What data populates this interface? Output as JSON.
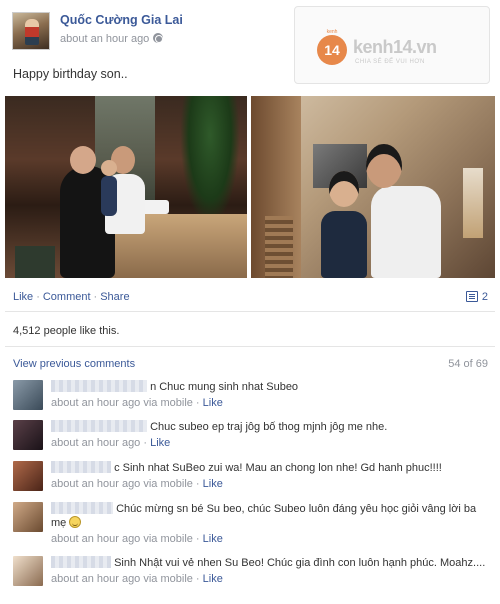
{
  "post": {
    "author": "Quốc Cường Gia Lai",
    "timestamp": "about an hour ago",
    "text": "Happy birthday son..",
    "watermark": {
      "logo": "14",
      "logo_top": "kenh",
      "brand": "kenh14.vn",
      "tagline": "CHIA SẺ ĐỂ VUI HƠN"
    }
  },
  "actions": {
    "like": "Like",
    "comment": "Comment",
    "share": "Share",
    "comment_count": "2"
  },
  "likes_text": "4,512 people like this.",
  "view_previous": "View previous comments",
  "page_count": "54 of 69",
  "comments": [
    {
      "text": "n Chuc mung sinh nhat Subeo",
      "meta": "about an hour ago via mobile · ",
      "like": "Like",
      "avatar_color": "#6a7a88"
    },
    {
      "text": "Chuc subeo ep traj jôg bố thog mjnh jôg me nhe.",
      "meta": "about an hour ago · ",
      "like": "Like",
      "avatar_color": "#3a2a30"
    },
    {
      "text": "c Sinh nhat SuBeo zui wa! Mau an chong lon nhe! Gd hanh phuc!!!!",
      "meta": "about an hour ago via mobile · ",
      "like": "Like",
      "avatar_color": "#8a4a3a"
    },
    {
      "text": "Chúc mừng sn bé Su beo, chúc Subeo luôn đáng yêu học giỏi vâng lời ba mẹ",
      "meta": "about an hour ago via mobile · ",
      "like": "Like",
      "avatar_color": "#b08a6a"
    },
    {
      "text": "Sinh Nhật vui vẻ nhen Su Beo! Chúc gia đình con luôn hạnh phúc. Moahz....",
      "meta": "about an hour ago via mobile · ",
      "like": "Like",
      "avatar_color": "#d8c4b0"
    }
  ]
}
